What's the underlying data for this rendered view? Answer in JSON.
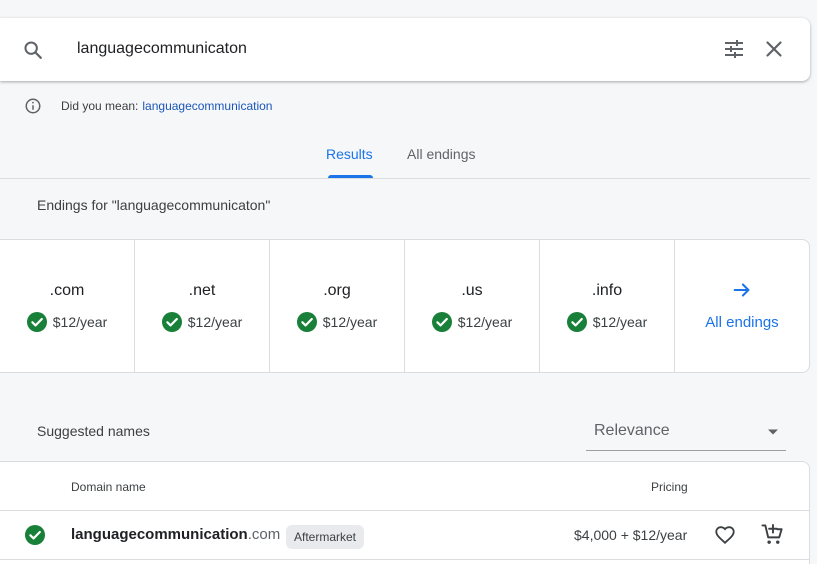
{
  "search": {
    "query": "languagecommunicaton",
    "icon": "search-icon",
    "filter_icon": "tune-icon",
    "clear_icon": "close-icon"
  },
  "did_you_mean": {
    "prefix": "Did you mean:",
    "suggestion": "languagecommunication"
  },
  "tabs": [
    {
      "label": "Results",
      "active": true
    },
    {
      "label": "All endings",
      "active": false
    }
  ],
  "endings": {
    "heading": "Endings for \"languagecommunicaton\"",
    "items": [
      {
        "ext": ".com",
        "price": "$12/year",
        "available": true
      },
      {
        "ext": ".net",
        "price": "$12/year",
        "available": true
      },
      {
        "ext": ".org",
        "price": "$12/year",
        "available": true
      },
      {
        "ext": ".us",
        "price": "$12/year",
        "available": true
      },
      {
        "ext": ".info",
        "price": "$12/year",
        "available": true
      }
    ],
    "all_label": "All endings"
  },
  "suggested": {
    "heading": "Suggested names",
    "sort_value": "Relevance"
  },
  "table": {
    "col_domain": "Domain name",
    "col_pricing": "Pricing",
    "rows": [
      {
        "name": "languagecommunication",
        "tld": ".com",
        "badge": "Aftermarket",
        "price": "$4,000 + $12/year",
        "available": true
      }
    ]
  },
  "colors": {
    "accent": "#1a73e8",
    "available": "#188038",
    "background": "#f6f7f9"
  }
}
